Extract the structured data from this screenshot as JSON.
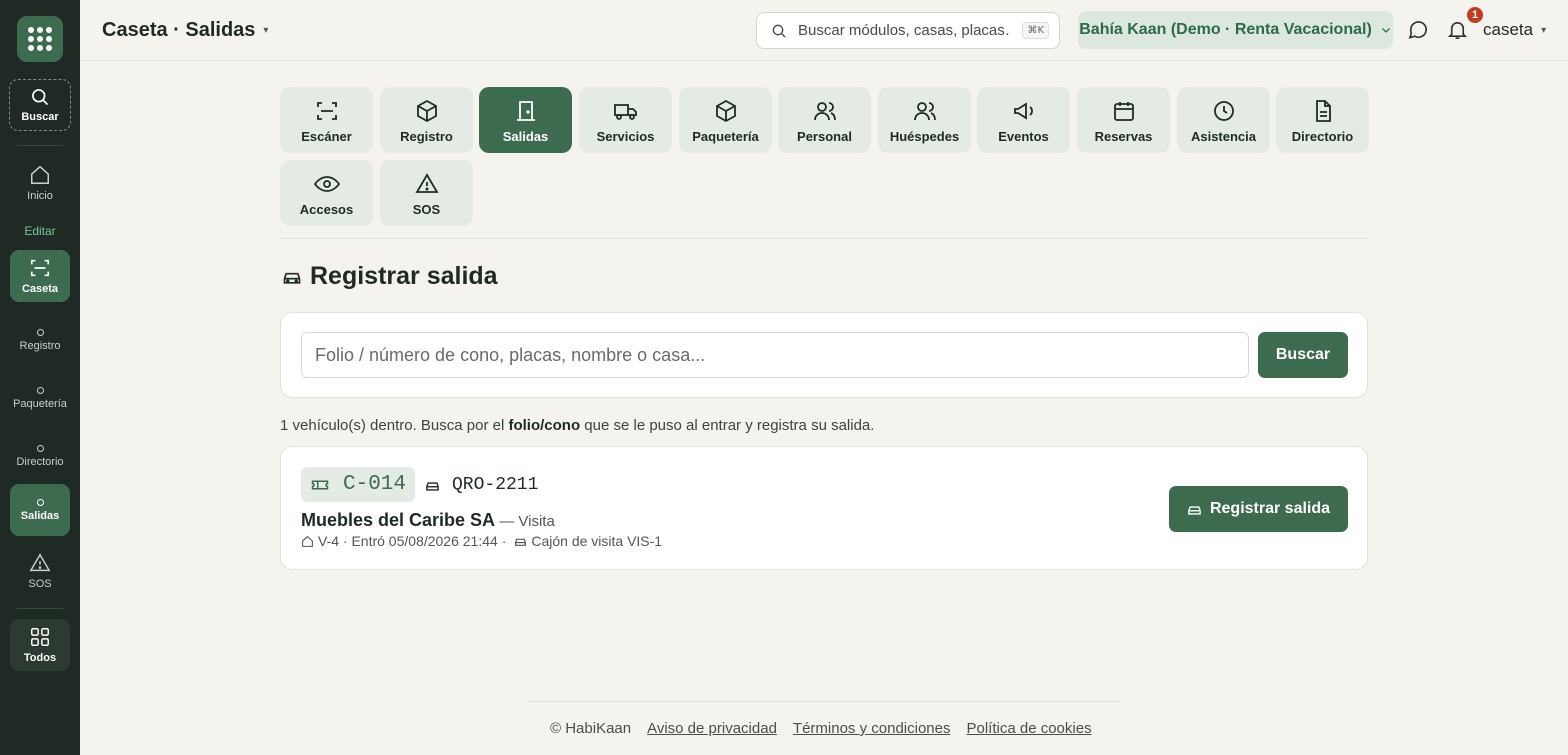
{
  "colors": {
    "sidebar": "#1f2a24",
    "accent": "#3d6b50",
    "tile": "#e3ebe4",
    "badge": "#c23b22"
  },
  "sidebar": {
    "search_label": "Buscar",
    "home_label": "Inicio",
    "edit_label": "Editar",
    "items": [
      {
        "label": "Caseta",
        "icon": "scan-icon"
      },
      {
        "label": "Registro",
        "icon": "dot-icon"
      },
      {
        "label": "Paquetería",
        "icon": "dot-icon"
      },
      {
        "label": "Directorio",
        "icon": "dot-icon"
      },
      {
        "label": "Salidas",
        "icon": "dot-icon"
      },
      {
        "label": "SOS",
        "icon": "warning-icon"
      }
    ],
    "all_label": "Todos"
  },
  "header": {
    "title": "Caseta · Salidas",
    "search_placeholder": "Buscar módulos, casas, placas…",
    "shortcut": "⌘K",
    "org": "Bahía Kaan (Demo · Renta Vacacional)",
    "notifications_count": "1",
    "user": "caseta"
  },
  "modules": [
    {
      "label": "Escáner",
      "icon": "scan-icon"
    },
    {
      "label": "Registro",
      "icon": "box-icon"
    },
    {
      "label": "Salidas",
      "icon": "door-icon",
      "active": true
    },
    {
      "label": "Servicios",
      "icon": "truck-icon"
    },
    {
      "label": "Paquetería",
      "icon": "box-icon"
    },
    {
      "label": "Personal",
      "icon": "users-icon"
    },
    {
      "label": "Huéspedes",
      "icon": "users-icon"
    },
    {
      "label": "Eventos",
      "icon": "megaphone-icon"
    },
    {
      "label": "Reservas",
      "icon": "calendar-icon"
    },
    {
      "label": "Asistencia",
      "icon": "clock-icon"
    },
    {
      "label": "Directorio",
      "icon": "file-icon"
    },
    {
      "label": "Accesos",
      "icon": "eye-icon"
    },
    {
      "label": "SOS",
      "icon": "warning-icon"
    }
  ],
  "main": {
    "title": "Registrar salida",
    "folio_placeholder": "Folio / número de cono, placas, nombre o casa...",
    "search_button": "Buscar",
    "info_prefix": "1 vehículo(s) dentro. Busca por el ",
    "info_bold": "folio/cono",
    "info_suffix": " que se le puso al entrar y registra su salida."
  },
  "vehicle": {
    "folio": "C-014",
    "plate": "QRO-2211",
    "name": "Muebles del Caribe SA",
    "type": " — Visita",
    "house_entry": "V-4 · Entró 05/08/2026 21:44 ·",
    "parking": "Cajón de visita VIS-1",
    "exit_button": "Registrar salida"
  },
  "footer": {
    "copyright": "© HabiKaan",
    "privacy": "Aviso de privacidad",
    "terms": "Términos y condiciones",
    "cookies": "Política de cookies"
  }
}
